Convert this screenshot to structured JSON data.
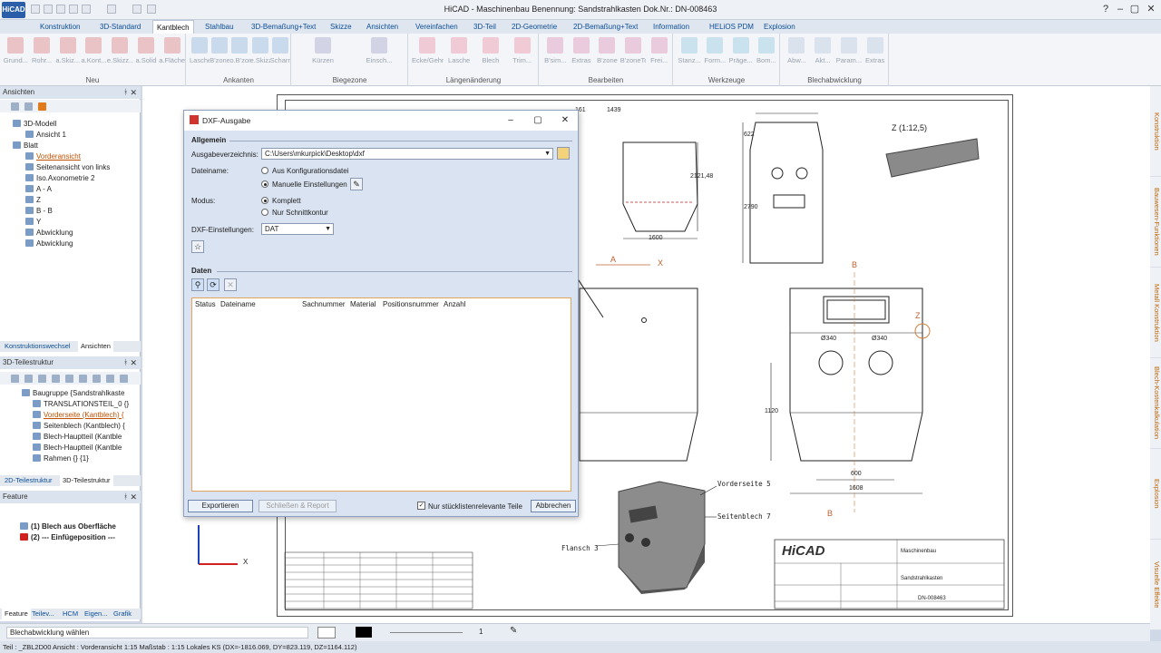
{
  "app": {
    "title": "HiCAD - Maschinenbau  Benennung: Sandstrahlkasten  Dok.Nr.: DN-008463",
    "logo": "HiCAD"
  },
  "menu_tabs": [
    "Konstruktion",
    "3D-Standard",
    "Kantblech",
    "Stahlbau",
    "3D-Bemaßung+Text",
    "Skizze",
    "Ansichten",
    "Vereinfachen",
    "3D-Teil",
    "2D-Geometrie",
    "2D-Bemaßung+Text",
    "Information",
    "HELiOS PDM",
    "Explosion"
  ],
  "active_tab": "Kantblech",
  "ribbon": {
    "groups": [
      {
        "label": "Neu",
        "buttons": [
          "Grund...",
          "Rohr...",
          "a.Skiz...",
          "a.Kont...",
          "e.Skizz...",
          "a.Solid",
          "a.Fläche"
        ]
      },
      {
        "label": "Ankanten",
        "buttons": [
          "Lasche",
          "B'zone",
          "o.B'zone",
          "e.Skizz...",
          "Scharnier"
        ]
      },
      {
        "label": "Biegezone",
        "buttons": [
          "Kürzen",
          "Einsch..."
        ]
      },
      {
        "label": "Längenänderung",
        "buttons": [
          "Ecke/Gehrung",
          "Lasche",
          "Blech",
          "Trim..."
        ]
      },
      {
        "label": "Bearbeiten",
        "buttons": [
          "B'sim...",
          "Extras",
          "B'zone",
          "B'zoneTopf",
          "Frei..."
        ]
      },
      {
        "label": "Werkzeuge",
        "buttons": [
          "Stanz...",
          "Form...",
          "Präge...",
          "Bom..."
        ]
      },
      {
        "label": "Blechabwicklung",
        "buttons": [
          "Abw...",
          "Akt...",
          "Param...",
          "Extras"
        ]
      }
    ]
  },
  "right_tabs": [
    "Konstruktion",
    "Bauwesen-Funktionen",
    "Metall Konstruktion",
    "Blech-Kostenkalkulation",
    "Explosion",
    "Visuelle Effekte"
  ],
  "panels": {
    "ansichten": {
      "title": "Ansichten",
      "items": [
        "3D-Modell",
        "Ansicht 1",
        "Blatt",
        "Vorderansicht",
        "Seitenansicht von links",
        "Iso.Axonometrie 2",
        "A - A",
        "Z",
        "B - B",
        "Y",
        "Abwicklung",
        "Abwicklung"
      ],
      "tabs": [
        "Konstruktionswechsel",
        "Ansichten"
      ]
    },
    "teilestruktur": {
      "title": "3D-Teilestruktur",
      "items": [
        "Baugruppe {Sandstrahlkaste",
        "TRANSLATIONSTEIL_0 {}",
        "Vorderseite (Kantblech) {",
        "Seitenblech (Kantblech) {",
        "Blech-Hauptteil (Kantble",
        "Blech-Hauptteil (Kantble",
        "Rahmen {} {1}"
      ],
      "tabs": [
        "2D-Teilestruktur",
        "3D-Teilestruktur"
      ]
    },
    "feature": {
      "title": "Feature",
      "items": [
        "(1) Blech aus Oberfläche",
        "(2) --- Einfügeposition ---"
      ],
      "tabs": [
        "Feature",
        "Teilev...",
        "HCM",
        "Eigen...",
        "Grafik"
      ]
    }
  },
  "dialog": {
    "title": "DXF-Ausgabe",
    "section_general": "Allgemein",
    "output_dir_label": "Ausgabeverzeichnis:",
    "output_dir": "C:\\Users\\mkurpick\\Desktop\\dxf",
    "filename_label": "Dateiname:",
    "filename_options": [
      "Aus Konfigurationsdatei",
      "Manuelle Einstellungen"
    ],
    "filename_selected": "Manuelle Einstellungen",
    "mode_label": "Modus:",
    "mode_options": [
      "Komplett",
      "Nur Schnittkontur"
    ],
    "mode_selected": "Komplett",
    "dxf_settings_label": "DXF-Einstellungen:",
    "dxf_settings_value": "DAT",
    "section_data": "Daten",
    "columns": [
      "Status",
      "Dateiname",
      "Sachnummer",
      "Material",
      "Positionsnummer",
      "Anzahl"
    ],
    "rows": [],
    "buttons": {
      "export": "Exportieren",
      "close_report": "Schließen & Report",
      "cancel": "Abbrechen"
    },
    "checkbox_label": "Nur stücklistenrelevante Teile",
    "checkbox_checked": true
  },
  "drawing": {
    "view_label": "Z (1:12,5)",
    "dims": [
      "161",
      "1439",
      "622",
      "2121,48",
      "1600",
      "2790",
      "Ø340",
      "Ø340",
      "1120",
      "600",
      "1608"
    ],
    "sections": [
      "B",
      "B",
      "A",
      "X",
      "Z"
    ],
    "callouts": [
      "Vorderseite 5",
      "Seitenblech 7",
      "Flansch 3"
    ],
    "titleblock": {
      "company": "HiCAD",
      "field1": "Maschinenbau",
      "field2": "Sandstrahlkasten",
      "docnr": "DN-008463"
    }
  },
  "status": {
    "prompt": "Blechabwicklung wählen",
    "line_weight": "1",
    "bottom": "Teil : _ZBL2D00   Ansicht : Vorderansicht 1:15   Maßstab : 1:15   Lokales KS  (DX=-1816.069, DY=823.119, DZ=1164.112)"
  },
  "colors": {
    "accent": "#e2a35a",
    "link": "#0b4d96",
    "selected": "#c05000",
    "titlebar": "#eef1f6"
  }
}
